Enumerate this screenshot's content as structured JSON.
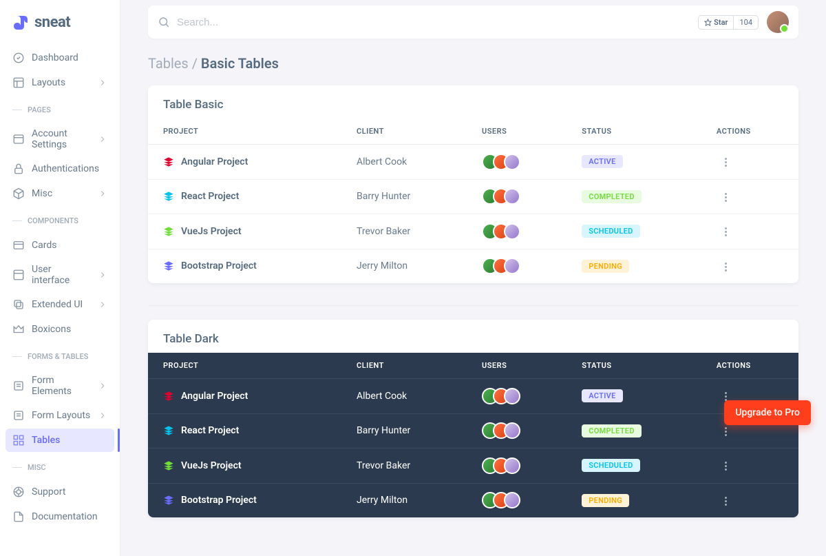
{
  "brand": "sneat",
  "topbar": {
    "search_placeholder": "Search...",
    "star_label": "Star",
    "star_count": "104"
  },
  "sidebar": {
    "main": [
      {
        "label": "Dashboard",
        "icon": "home"
      },
      {
        "label": "Layouts",
        "icon": "layout",
        "chevron": true
      }
    ],
    "sections": [
      {
        "title": "PAGES",
        "items": [
          {
            "label": "Account Settings",
            "icon": "window",
            "chevron": true
          },
          {
            "label": "Authentications",
            "icon": "lock",
            "chevron": true
          },
          {
            "label": "Misc",
            "icon": "cube",
            "chevron": true
          }
        ]
      },
      {
        "title": "COMPONENTS",
        "items": [
          {
            "label": "Cards",
            "icon": "card"
          },
          {
            "label": "User interface",
            "icon": "collection",
            "chevron": true
          },
          {
            "label": "Extended UI",
            "icon": "copy",
            "chevron": true
          },
          {
            "label": "Boxicons",
            "icon": "crown"
          }
        ]
      },
      {
        "title": "FORMS & TABLES",
        "items": [
          {
            "label": "Form Elements",
            "icon": "detail",
            "chevron": true
          },
          {
            "label": "Form Layouts",
            "icon": "detail",
            "chevron": true
          },
          {
            "label": "Tables",
            "icon": "grid",
            "active": true
          }
        ]
      },
      {
        "title": "MISC",
        "items": [
          {
            "label": "Support",
            "icon": "support"
          },
          {
            "label": "Documentation",
            "icon": "file"
          }
        ]
      }
    ]
  },
  "breadcrumb": {
    "parent": "Tables",
    "current": "Basic Tables"
  },
  "tables": {
    "headers": [
      "PROJECT",
      "CLIENT",
      "USERS",
      "STATUS",
      "ACTIONS"
    ],
    "rows": [
      {
        "project": "Angular Project",
        "icon_color": "#dd0330",
        "client": "Albert Cook",
        "status": "ACTIVE",
        "status_class": "active"
      },
      {
        "project": "React Project",
        "icon_color": "#03c3ec",
        "client": "Barry Hunter",
        "status": "COMPLETED",
        "status_class": "completed"
      },
      {
        "project": "VueJs Project",
        "icon_color": "#71dd37",
        "client": "Trevor Baker",
        "status": "SCHEDULED",
        "status_class": "scheduled"
      },
      {
        "project": "Bootstrap Project",
        "icon_color": "#696cff",
        "client": "Jerry Milton",
        "status": "PENDING",
        "status_class": "pending"
      }
    ],
    "basic_title": "Table Basic",
    "dark_title": "Table Dark"
  },
  "upgrade_label": "Upgrade to Pro"
}
